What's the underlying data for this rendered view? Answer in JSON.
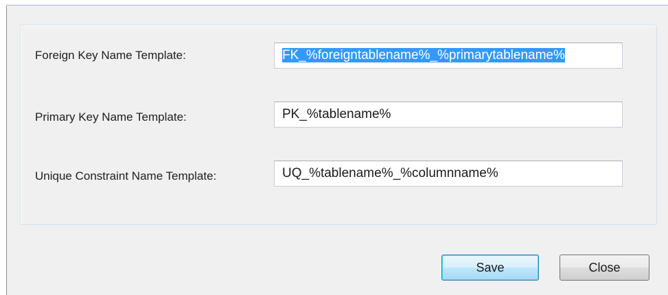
{
  "dialog": {
    "fields": [
      {
        "label": "Foreign Key Name Template:",
        "value": "FK_%foreigntablename%_%primarytablename%"
      },
      {
        "label": "Primary Key Name Template:",
        "value": "PK_%tablename%"
      },
      {
        "label": "Unique Constraint Name Template:",
        "value": "UQ_%tablename%_%columnname%"
      }
    ],
    "buttons": {
      "save_label": "Save",
      "close_label": "Close"
    },
    "colors": {
      "selection": "#3399ff",
      "default_button_border": "#3c7fb1"
    }
  }
}
